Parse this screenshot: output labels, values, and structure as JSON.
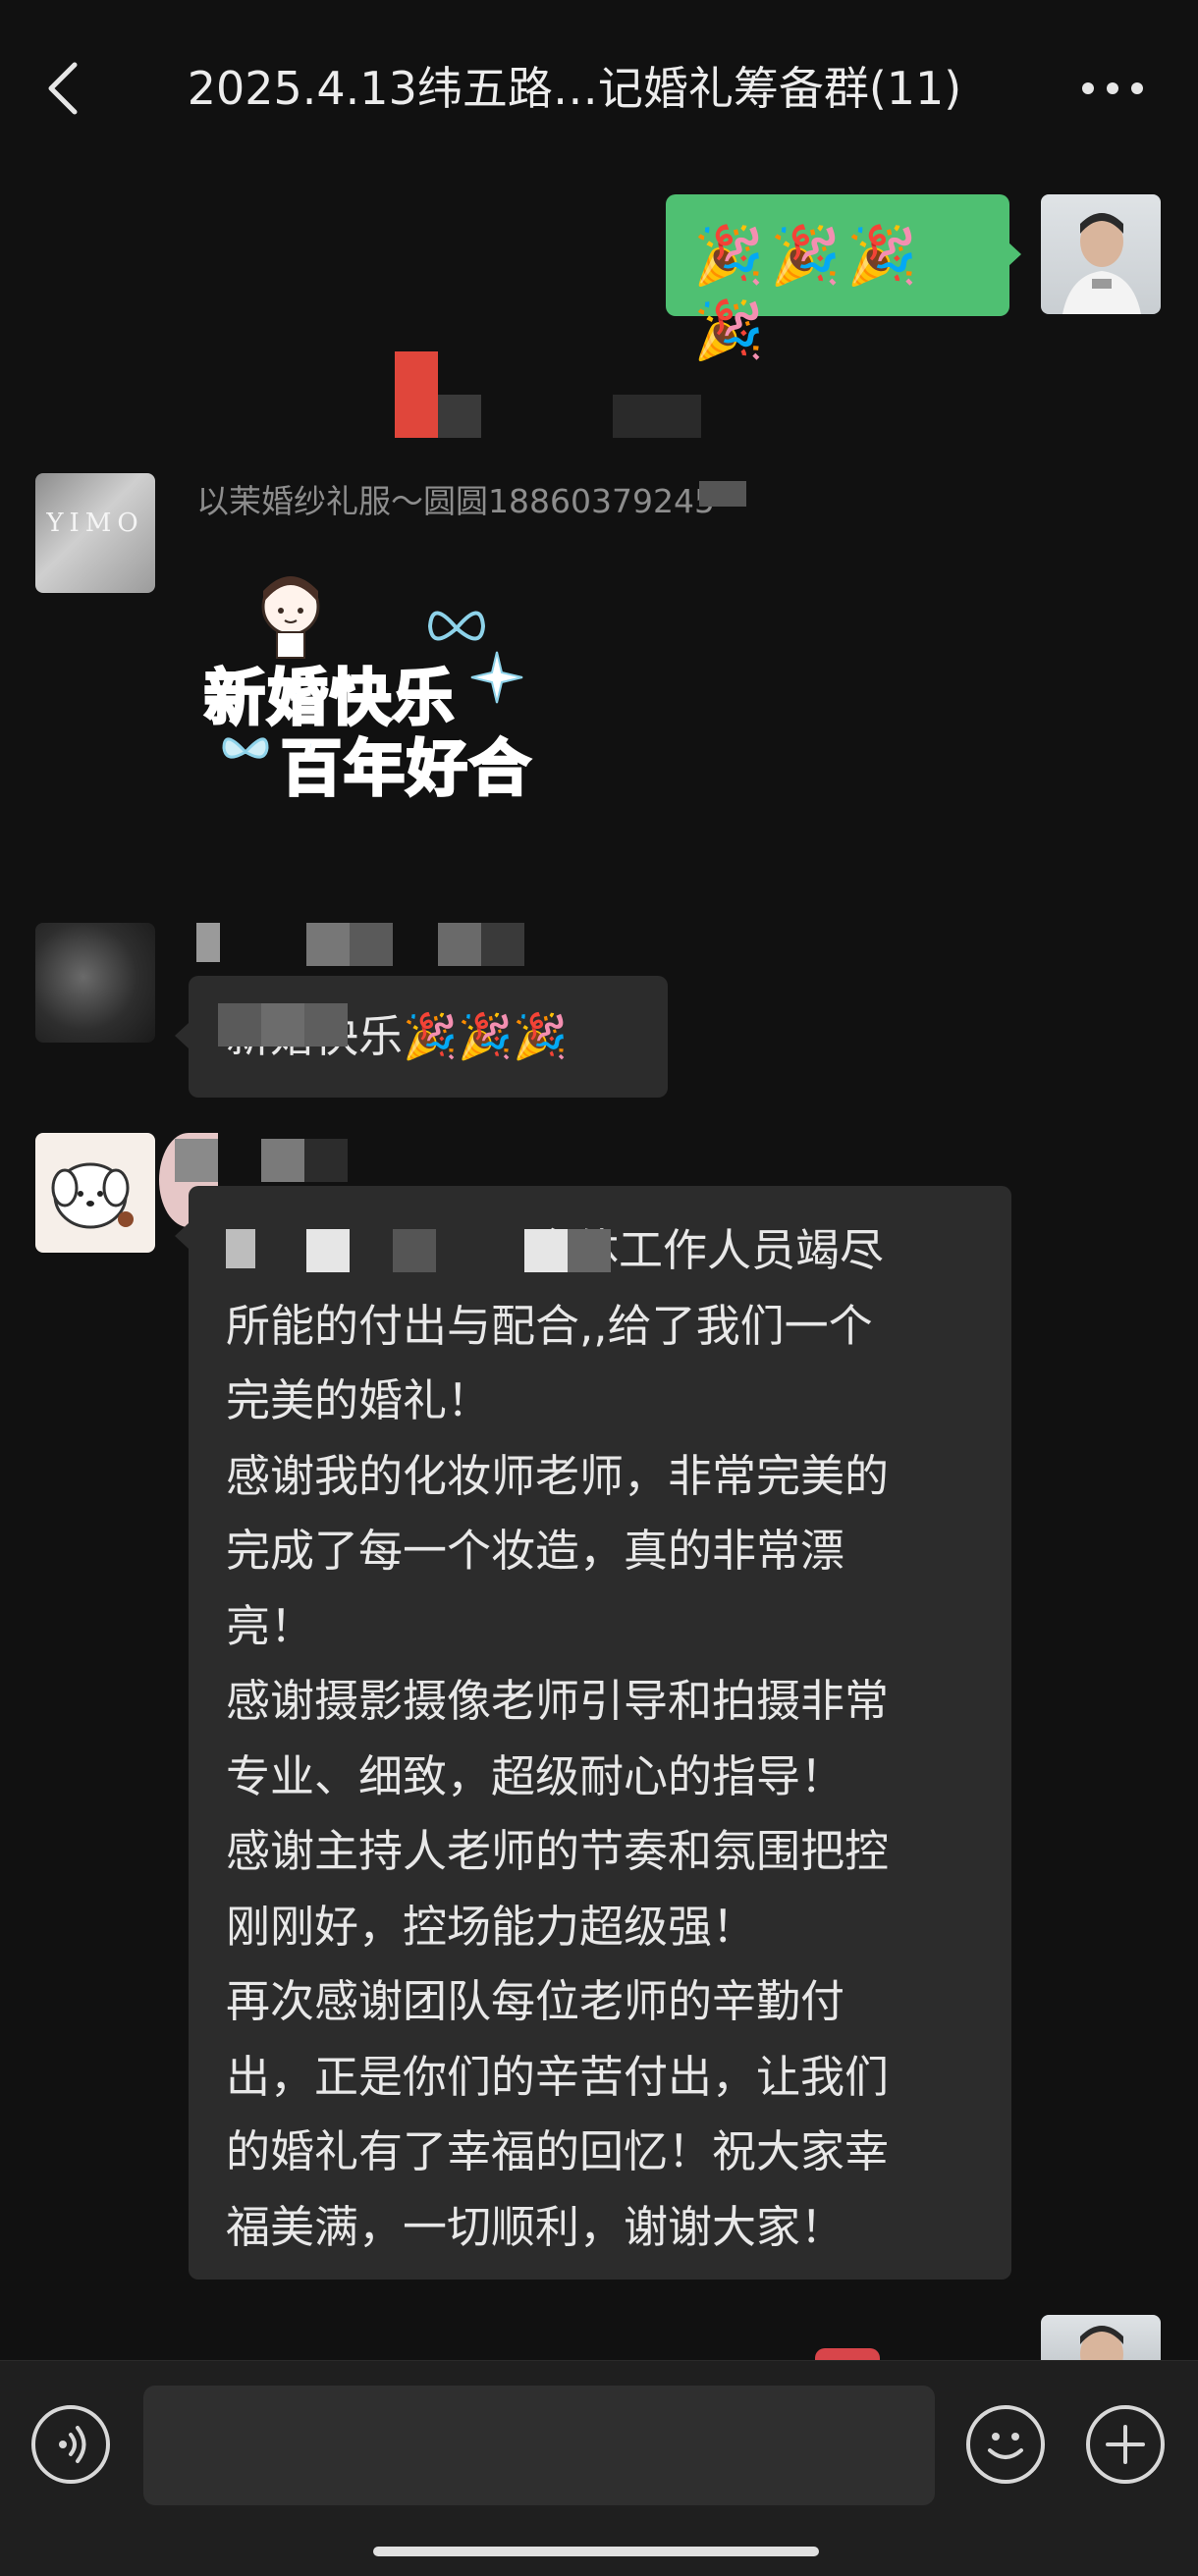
{
  "header": {
    "title": "2025.4.13纬五路…记婚礼筹备群(11)",
    "back_icon": "chevron-left-icon",
    "more_icon": "more-dots-icon"
  },
  "messages": [
    {
      "side": "right",
      "type": "emoji",
      "text": "🎉🎉🎉🎉"
    },
    {
      "side": "left",
      "type": "sticker",
      "sender": "以茉婚纱礼服～圆圆18860379245",
      "avatar_text": "YIMO",
      "sticker_line1": "新婚快乐",
      "sticker_line2": "百年好合"
    },
    {
      "side": "left",
      "type": "text",
      "text": "新婚快乐🎉🎉🎉"
    },
    {
      "side": "left",
      "type": "text",
      "lines": [
        "全体工作人员竭尽",
        "所能的付出与配合,,给了我们一个",
        "完美的婚礼！",
        "感谢我的化妆师老师，非常完美的",
        "完成了每一个妆造，真的非常漂",
        "亮！",
        "感谢摄影摄像老师引导和拍摄非常",
        "专业、细致，超级耐心的指导！",
        "感谢主持人老师的节奏和氛围把控",
        "刚刚好，控场能力超级强！",
        "再次感谢团队每位老师的辛勤付",
        "出，正是你们的辛苦付出，让我们",
        "的婚礼有了幸福的回忆！祝大家幸",
        "福美满，一切顺利，谢谢大家！"
      ]
    }
  ],
  "bottom_bar": {
    "voice_icon": "voice-icon",
    "emoji_icon": "smiley-icon",
    "plus_icon": "plus-icon"
  }
}
